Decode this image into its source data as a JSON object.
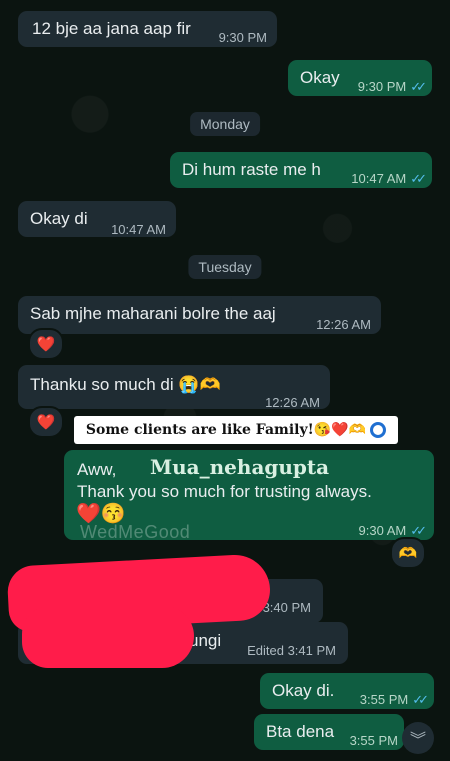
{
  "messages": [
    {
      "text": "12 bje aa jana aap fir",
      "time": "9:30 PM"
    },
    {
      "text": "Okay",
      "time": "9:30 PM"
    },
    {
      "text": "Di hum raste me h",
      "time": "10:47 AM"
    },
    {
      "text": "Okay di",
      "time": "10:47 AM"
    },
    {
      "text": "Sab mjhe maharani bolre the aaj",
      "time": "12:26 AM"
    },
    {
      "text": "Thanku so much di 😭🫶",
      "time": "12:26 AM"
    },
    {
      "text": "Aww,",
      "text2": "Thank you so much for trusting always.",
      "emoji": "❤️😚",
      "time": "9:30 AM"
    },
    {
      "time": "3:40 PM"
    },
    {
      "text": "ungi",
      "time": "Edited 3:41 PM"
    },
    {
      "text": "Okay di.",
      "time": "3:55 PM"
    },
    {
      "text": "Bta dena",
      "time": "3:55 PM"
    }
  ],
  "day_separators": [
    "Monday",
    "Tuesday"
  ],
  "reactions": [
    "❤️",
    "❤️",
    "🫶"
  ],
  "overlay": {
    "banner": "Some clients are like Family!😘❤️🫶",
    "handle": "Mua_nehagupta",
    "watermark": "WedMeGood"
  },
  "icons": {
    "read": "double-check-icon",
    "scroll": "chevron-double-down-icon"
  },
  "colors": {
    "incoming": "#1f2c33",
    "outgoing": "#0f5d41",
    "read_ticks": "#53bdeb",
    "redaction": "#ff1c4a"
  }
}
